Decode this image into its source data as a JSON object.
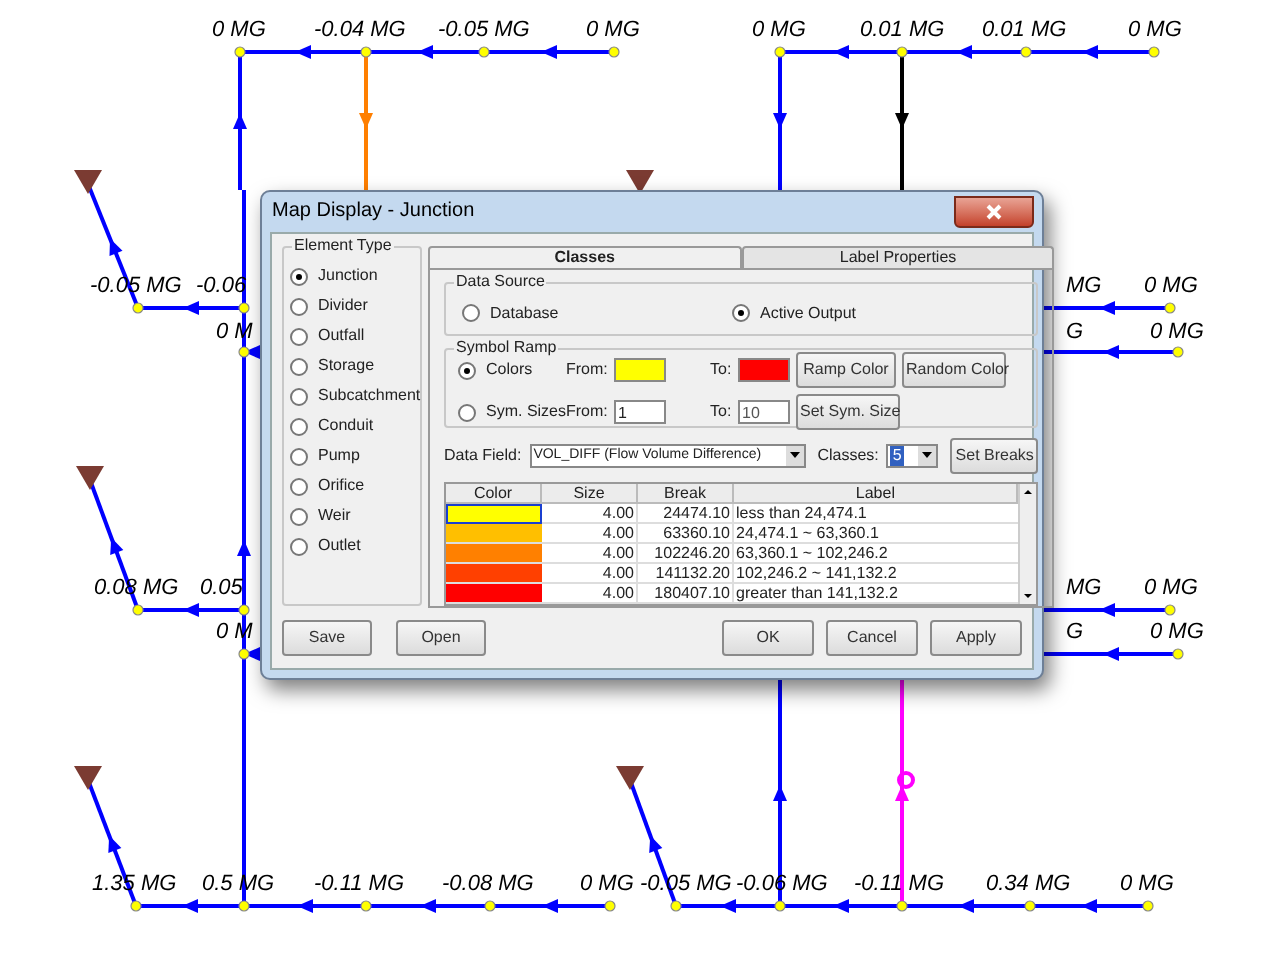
{
  "map": {
    "labels": [
      "0 MG",
      "-0.04 MG",
      "-0.05 MG",
      "0 MG",
      "0 MG",
      "0.01 MG",
      "0.01 MG",
      "0 MG",
      "-0.05 MG",
      "-0.06",
      "MG",
      "0 MG",
      "0 M",
      "G",
      "0 MG",
      "0.08 MG",
      "0.05",
      "MG",
      "0 MG",
      "0 M",
      "G",
      "0 MG",
      "1.35 MG",
      "0.5 MG",
      "-0.11 MG",
      "-0.08 MG",
      "0 MG",
      "-0.05 MG",
      "-0.06 MG",
      "-0.11 MG",
      "0.34 MG",
      "0 MG"
    ]
  },
  "dialog": {
    "title": "Map Display - Junction",
    "element_type": {
      "label": "Element Type",
      "options": [
        {
          "label": "Junction",
          "selected": true
        },
        {
          "label": "Divider",
          "selected": false
        },
        {
          "label": "Outfall",
          "selected": false
        },
        {
          "label": "Storage",
          "selected": false
        },
        {
          "label": "Subcatchment",
          "selected": false
        },
        {
          "label": "Conduit",
          "selected": false
        },
        {
          "label": "Pump",
          "selected": false
        },
        {
          "label": "Orifice",
          "selected": false
        },
        {
          "label": "Weir",
          "selected": false
        },
        {
          "label": "Outlet",
          "selected": false
        }
      ]
    },
    "tabs": [
      {
        "label": "Classes",
        "selected": true
      },
      {
        "label": "Label Properties",
        "selected": false
      }
    ],
    "data_source": {
      "label": "Data Source",
      "options": [
        {
          "label": "Database",
          "selected": false
        },
        {
          "label": "Active Output",
          "selected": true
        }
      ]
    },
    "symbol_ramp": {
      "label": "Symbol Ramp",
      "options": [
        {
          "label": "Colors",
          "selected": true
        },
        {
          "label": "Sym. Sizes",
          "selected": false
        }
      ],
      "from_labels": [
        "From:",
        "From:"
      ],
      "to_labels": [
        "To:",
        "To:"
      ],
      "from_swatch": {
        "color": "#ffff00"
      },
      "to_swatch": {
        "color": "#ff0000"
      },
      "from_size": "1",
      "to_size": "10",
      "buttons": [
        "Ramp Color",
        "Random Color",
        "Set Sym. Size"
      ]
    },
    "data_field": {
      "label": "Data Field:",
      "value": "VOL_DIFF (Flow Volume Difference)"
    },
    "classes": {
      "label": "Classes:",
      "value": "5"
    },
    "set_breaks": "Set Breaks",
    "table": {
      "columns": [
        "Color",
        "Size",
        "Break",
        "Label"
      ],
      "rows": [
        {
          "color": "#ffff00",
          "size": "4.00",
          "break": "24474.10",
          "label": "less than 24,474.1",
          "selected": true
        },
        {
          "color": "#ffbf00",
          "size": "4.00",
          "break": "63360.10",
          "label": "24,474.1 ~ 63,360.1",
          "selected": false
        },
        {
          "color": "#ff8000",
          "size": "4.00",
          "break": "102246.20",
          "label": "63,360.1 ~ 102,246.2",
          "selected": false
        },
        {
          "color": "#ff4000",
          "size": "4.00",
          "break": "141132.20",
          "label": "102,246.2 ~ 141,132.2",
          "selected": false
        },
        {
          "color": "#ff0000",
          "size": "4.00",
          "break": "180407.10",
          "label": "greater than 141,132.2",
          "selected": false
        }
      ]
    },
    "left_buttons": [
      "Save",
      "Open"
    ],
    "right_buttons": [
      "OK",
      "Cancel",
      "Apply"
    ]
  }
}
